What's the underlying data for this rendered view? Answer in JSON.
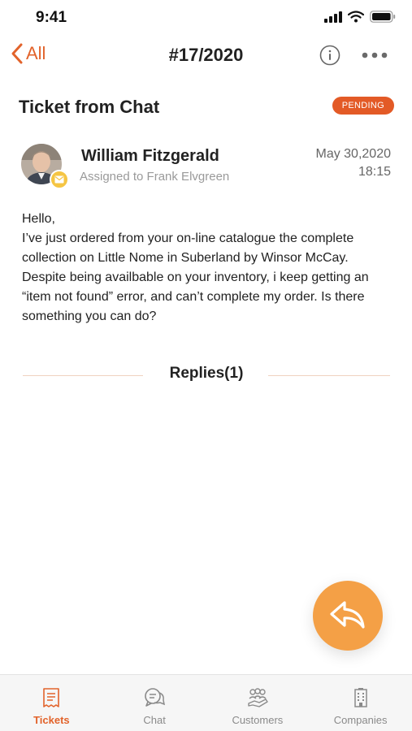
{
  "status_bar": {
    "time": "9:41"
  },
  "nav": {
    "back_label": "All",
    "title": "#17/2020"
  },
  "ticket": {
    "title": "Ticket from Chat",
    "status": "PENDING",
    "sender_name": "William Fitzgerald",
    "assigned_to": "Assigned to Frank Elvgreen",
    "date": "May 30,2020",
    "time": "18:15",
    "message": "Hello,\nI’ve just ordered from your on-line catalogue the complete collection on Little Nome in Suberland by Winsor McCay. Despite being availbable on your inventory, i keep getting an “item not found” error, and can’t complete my order. Is there something you can do?"
  },
  "replies": {
    "label": "Replies(1)"
  },
  "tabs": [
    {
      "label": "Tickets",
      "icon": "ticket-icon",
      "active": true
    },
    {
      "label": "Chat",
      "icon": "chat-icon",
      "active": false
    },
    {
      "label": "Customers",
      "icon": "customers-icon",
      "active": false
    },
    {
      "label": "Companies",
      "icon": "companies-icon",
      "active": false
    }
  ],
  "colors": {
    "accent": "#e2632b",
    "badge": "#e35a26",
    "fab": "#f4a046",
    "channel_badge": "#f5c543"
  }
}
